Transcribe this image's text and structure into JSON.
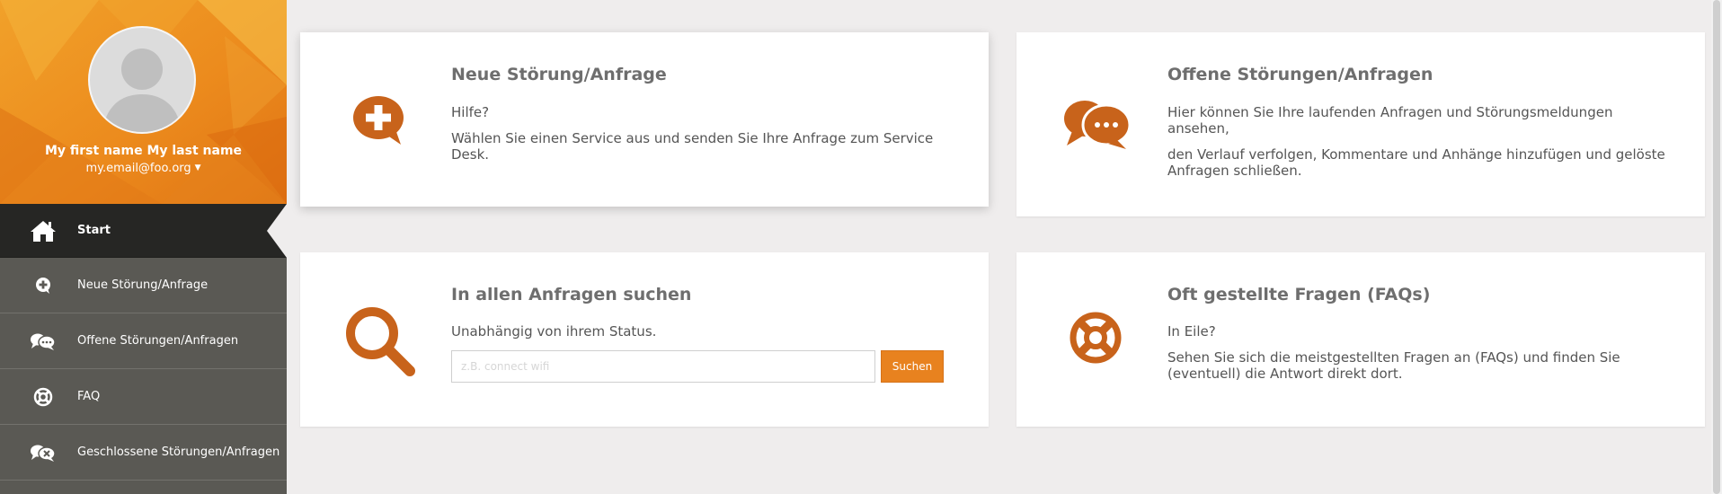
{
  "colors": {
    "accent": "#e8821f",
    "icon": "#c8631b",
    "sidebar_bg": "#5a5954",
    "sidebar_active": "#262624",
    "content_bg": "#efeded"
  },
  "user": {
    "name": "My first name My last name",
    "email": "my.email@foo.org",
    "avatar_icon": "user-silhouette-icon",
    "dropdown_icon": "caret-down-icon"
  },
  "nav": {
    "items": [
      {
        "label": "Start",
        "icon": "home-icon",
        "active": true
      },
      {
        "label": "Neue Störung/Anfrage",
        "icon": "plus-bubble-icon",
        "active": false
      },
      {
        "label": "Offene Störungen/Anfragen",
        "icon": "chat-bubbles-icon",
        "active": false
      },
      {
        "label": "FAQ",
        "icon": "lifebuoy-icon",
        "active": false
      },
      {
        "label": "Geschlossene Störungen/Anfragen",
        "icon": "closed-bubbles-icon",
        "active": false
      }
    ]
  },
  "cards": {
    "new_request": {
      "icon": "plus-bubble-icon",
      "title": "Neue Störung/Anfrage",
      "line1": "Hilfe?",
      "line2": "Wählen Sie einen Service aus und senden Sie Ihre Anfrage zum Service Desk."
    },
    "open_requests": {
      "icon": "chat-bubbles-icon",
      "title": "Offene Störungen/Anfragen",
      "line1": "Hier können Sie Ihre laufenden Anfragen und Störungsmeldungen ansehen,",
      "line2": "den Verlauf verfolgen, Kommentare und Anhänge hinzufügen und gelöste Anfragen schließen."
    },
    "search": {
      "icon": "magnifier-icon",
      "title": "In allen Anfragen suchen",
      "line1": "Unabhängig von ihrem Status.",
      "placeholder": "z.B. connect wifi",
      "value": "",
      "button_label": "Suchen"
    },
    "faq": {
      "icon": "lifebuoy-icon",
      "title": "Oft gestellte Fragen (FAQs)",
      "line1": "In Eile?",
      "line2": "Sehen Sie sich die meistgestellten Fragen an (FAQs) und finden Sie (eventuell) die Antwort direkt dort."
    }
  }
}
